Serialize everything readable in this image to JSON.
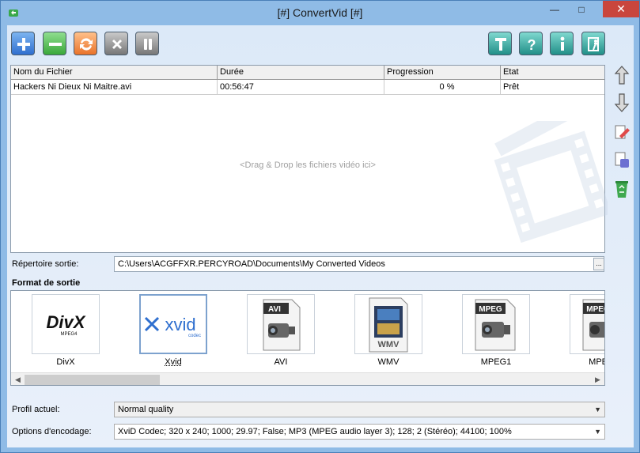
{
  "window": {
    "title": "[#] ConvertVid [#]",
    "minimize": "—",
    "maximize": "□",
    "close": "✕"
  },
  "toolbar": {
    "left": [
      {
        "name": "add-icon"
      },
      {
        "name": "remove-icon"
      },
      {
        "name": "convert-icon"
      },
      {
        "name": "stop-icon"
      },
      {
        "name": "pause-icon"
      }
    ],
    "right": [
      {
        "name": "settings-t-icon"
      },
      {
        "name": "help-icon"
      },
      {
        "name": "info-icon"
      },
      {
        "name": "exit-icon"
      }
    ]
  },
  "grid": {
    "columns": [
      "Nom du Fichier",
      "Durée",
      "Progression",
      "Etat"
    ],
    "rows": [
      {
        "file": "Hackers Ni Dieux Ni Maitre.avi",
        "duration": "00:56:47",
        "progress": "0 %",
        "state": "Prêt"
      }
    ],
    "drop_hint": "<Drag & Drop les fichiers vidéo ici>"
  },
  "side_buttons": [
    "move-up-icon",
    "move-down-icon",
    "edit-icon",
    "properties-icon",
    "recycle-bin-icon"
  ],
  "output": {
    "dir_label": "Répertoire sortie:",
    "dir_value": "C:\\Users\\ACGFFXR.PERCYROAD\\Documents\\My Converted Videos",
    "browse": "...",
    "format_heading": "Format de sortie"
  },
  "formats": [
    {
      "label": "DivX",
      "selected": false
    },
    {
      "label": "Xvid",
      "selected": true
    },
    {
      "label": "AVI",
      "selected": false
    },
    {
      "label": "WMV",
      "selected": false
    },
    {
      "label": "MPEG1",
      "selected": false
    },
    {
      "label": "MPE",
      "selected": false
    }
  ],
  "format_logos": {
    "divx": "DivX",
    "divx_sub": "MPEG4",
    "xvid": "xvid",
    "xvid_sub": "codec",
    "avi": "AVI",
    "wmv": "WMV",
    "mpeg": "MPEG"
  },
  "profile": {
    "label": "Profil actuel:",
    "value": "Normal quality"
  },
  "encoding": {
    "label": "Options d'encodage:",
    "value": "XviD Codec; 320 x 240; 1000; 29.97; False; MP3 (MPEG audio layer 3); 128; 2 (Stéréo); 44100; 100%"
  },
  "colors": {
    "add": "#3f7fd6",
    "remove": "#4fb84f",
    "convert": "#f08a3c",
    "stop": "#8a8a8a",
    "pause": "#8a8a8a",
    "right_tools": "#2fa7a0"
  }
}
